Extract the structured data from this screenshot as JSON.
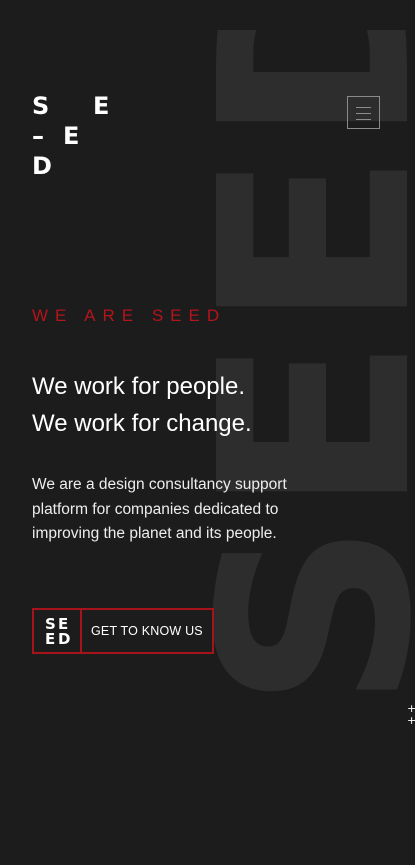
{
  "background": {
    "wordmark": "SEED",
    "page_color": "#1c1c1d",
    "wordmark_color": "#2e2d2d"
  },
  "logo": {
    "letters": [
      "S",
      "E",
      "–",
      "E",
      "D"
    ]
  },
  "menu": {
    "icon": "hamburger-menu-icon"
  },
  "hero": {
    "eyebrow": "WE ARE SEED",
    "headline_line1": "We work for people.",
    "headline_line2": "We work for change.",
    "description": "We are a design consultancy support platform for companies dedicated to improving the planet and its people."
  },
  "cta": {
    "logo_letters": [
      "S",
      "E",
      "E",
      "D"
    ],
    "label": "GET TO KNOW US",
    "accent_color": "#a7131a"
  },
  "decor": {
    "crosses": [
      "+",
      "+"
    ]
  }
}
